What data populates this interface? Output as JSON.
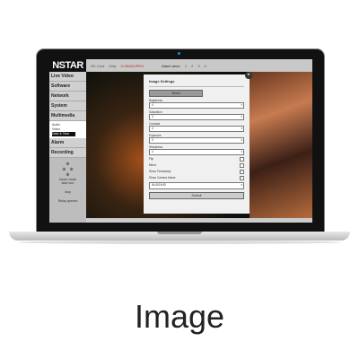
{
  "caption": "Image",
  "topbar": {
    "logo": "NSTAR",
    "items": [
      "SD Card",
      "Help",
      "H.264/MJPEG"
    ],
    "alarm_label": "Alarm area:",
    "alarm_areas": [
      "1",
      "2",
      "3",
      "4"
    ],
    "accent": "#cc2222"
  },
  "sidebar": {
    "items": [
      "Live Video",
      "Software",
      "Network",
      "System",
      "Multimedia"
    ],
    "sub": [
      "Audio",
      "Video",
      "Date & Time"
    ],
    "items2": [
      "Alarm",
      "Recording"
    ],
    "ptz": {
      "hscan": "hscan",
      "vscan": "vscan",
      "tour": "start tour",
      "stop": "stop"
    },
    "status": "Relay opened"
  },
  "dialog": {
    "title": "Image Settings",
    "reset": "Reset",
    "fields": [
      {
        "label": "Brightness",
        "value": "4"
      },
      {
        "label": "Saturation",
        "value": "3"
      },
      {
        "label": "Contrast",
        "value": "4"
      },
      {
        "label": "Exposure",
        "value": "0"
      },
      {
        "label": "Sharpness",
        "value": "4"
      }
    ],
    "checks": [
      {
        "label": "Flip",
        "checked": false
      },
      {
        "label": "Mirror",
        "checked": false
      },
      {
        "label": "Show Timestamp",
        "checked": true
      },
      {
        "label": "Show Camera Name",
        "checked": true
      }
    ],
    "camera_name": "IN-6014HD",
    "submit": "Submit"
  }
}
